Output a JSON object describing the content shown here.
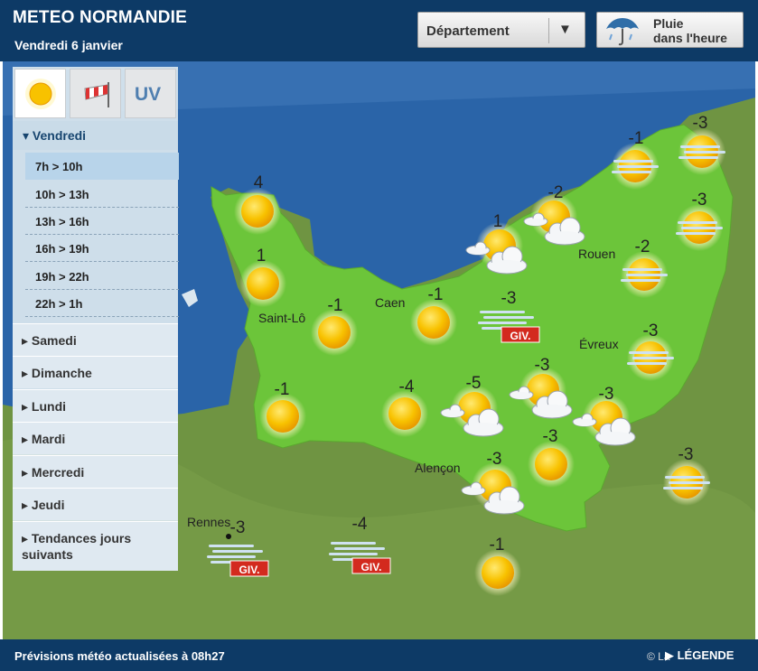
{
  "header": {
    "title": "METEO NORMANDIE",
    "date": "Vendredi 6 janvier",
    "department_label": "Département",
    "rain_line1": "Pluie",
    "rain_line2": "dans l'heure"
  },
  "tabs": [
    {
      "icon": "sun-icon",
      "active": true
    },
    {
      "icon": "windsock-icon",
      "active": false
    },
    {
      "label": "UV",
      "active": false
    }
  ],
  "sidebar": {
    "current_day": "▾ Vendredi",
    "slots": [
      "7h > 10h",
      "10h > 13h",
      "13h > 16h",
      "16h > 19h",
      "19h > 22h",
      "22h > 1h"
    ],
    "active_slot": "7h > 10h",
    "days": [
      "▸ Samedi",
      "▸ Dimanche",
      "▸ Lundi",
      "▸ Mardi",
      "▸ Mercredi",
      "▸ Jeudi"
    ],
    "trends": "▸ Tendances jours suivants"
  },
  "map": {
    "cities": [
      "Saint-Lô",
      "Caen",
      "Rouen",
      "Évreux",
      "Alençon",
      "Rennes"
    ],
    "forecasts": [
      {
        "temp": "4",
        "icon": "sun"
      },
      {
        "temp": "1",
        "icon": "sun"
      },
      {
        "temp": "-1",
        "icon": "sun"
      },
      {
        "temp": "-1",
        "icon": "sun"
      },
      {
        "temp": "-3",
        "icon": "frost"
      },
      {
        "temp": "-1",
        "icon": "sun"
      },
      {
        "temp": "-4",
        "icon": "sun"
      },
      {
        "temp": "-5",
        "icon": "sun-clouds"
      },
      {
        "temp": "-3",
        "icon": "sun-clouds"
      },
      {
        "temp": "-3",
        "icon": "sun-clouds"
      },
      {
        "temp": "-3",
        "icon": "sun"
      },
      {
        "temp": "-3",
        "icon": "sun-clouds"
      },
      {
        "temp": "1",
        "icon": "sun-clouds"
      },
      {
        "temp": "-2",
        "icon": "sun-clouds"
      },
      {
        "temp": "-1",
        "icon": "mist"
      },
      {
        "temp": "-3",
        "icon": "mist"
      },
      {
        "temp": "-3",
        "icon": "mist"
      },
      {
        "temp": "-2",
        "icon": "mist"
      },
      {
        "temp": "-3",
        "icon": "mist"
      },
      {
        "temp": "-3",
        "icon": "mist"
      },
      {
        "temp": "-3",
        "icon": "frost"
      },
      {
        "temp": "-4",
        "icon": "frost"
      },
      {
        "temp": "-1",
        "icon": "sun"
      }
    ],
    "frost_label": "GIV."
  },
  "footer": {
    "text": "Prévisions météo actualisées à 08h27",
    "legend": "▶ LÉGENDE",
    "copyright": "© La"
  },
  "colors": {
    "header_bg": "#0d3a66",
    "sea": "#2a64a8",
    "land_normandy": "#6cc53a",
    "land_other": "#6f9442",
    "sun": "#f8c200"
  }
}
